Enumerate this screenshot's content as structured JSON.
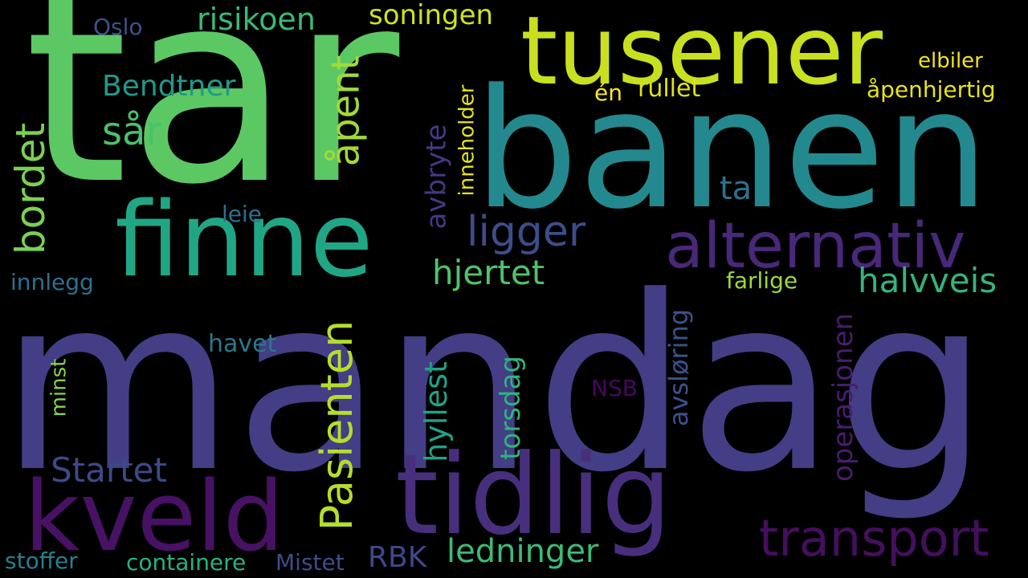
{
  "words": [
    {
      "text": "mandag",
      "color": "#433e85"
    },
    {
      "text": "tar",
      "color": "#5cc863"
    },
    {
      "text": "banen",
      "color": "#23898e"
    },
    {
      "text": "tusener",
      "color": "#c8e020"
    },
    {
      "text": "finne",
      "color": "#21a685"
    },
    {
      "text": "tidlig",
      "color": "#472f7d"
    },
    {
      "text": "kveld",
      "color": "#471164"
    },
    {
      "text": "alternativ",
      "color": "#482878"
    },
    {
      "text": "transport",
      "color": "#440f5d"
    },
    {
      "text": "Pasienten",
      "color": "#b5de2b"
    },
    {
      "text": "risikoen",
      "color": "#3aba76"
    },
    {
      "text": "soningen",
      "color": "#d0e11c"
    },
    {
      "text": "Bendtner",
      "color": "#1f9a8a"
    },
    {
      "text": "sår",
      "color": "#4ac16d"
    },
    {
      "text": "åpent",
      "color": "#a2da37"
    },
    {
      "text": "bordet",
      "color": "#7ad151"
    },
    {
      "text": "ligger",
      "color": "#3e4c8a"
    },
    {
      "text": "hjertet",
      "color": "#4ec36b"
    },
    {
      "text": "halvveis",
      "color": "#34b679"
    },
    {
      "text": "ta",
      "color": "#2c728e"
    },
    {
      "text": "avbryte",
      "color": "#443983"
    },
    {
      "text": "inneholder",
      "color": "#e5e419"
    },
    {
      "text": "Oslo",
      "color": "#3b528b"
    },
    {
      "text": "elbiler",
      "color": "#f1e51d"
    },
    {
      "text": "åpenhjertig",
      "color": "#e7e419"
    },
    {
      "text": "én",
      "color": "#fde725"
    },
    {
      "text": "rullet",
      "color": "#dde318"
    },
    {
      "text": "leie",
      "color": "#2d708e"
    },
    {
      "text": "innlegg",
      "color": "#2c718e"
    },
    {
      "text": "farlige",
      "color": "#9dd93b"
    },
    {
      "text": "avsløring",
      "color": "#3b528b"
    },
    {
      "text": "operasjonen",
      "color": "#481d6f"
    },
    {
      "text": "havet",
      "color": "#2a788e"
    },
    {
      "text": "hyllest",
      "color": "#20a386"
    },
    {
      "text": "torsdag",
      "color": "#2fb47c"
    },
    {
      "text": "NSB",
      "color": "#46085c"
    },
    {
      "text": "minst",
      "color": "#84d44b"
    },
    {
      "text": "Startet",
      "color": "#3e4989"
    },
    {
      "text": "RBK",
      "color": "#3f4889"
    },
    {
      "text": "ledninger",
      "color": "#3cbb75"
    },
    {
      "text": "stoffer",
      "color": "#277f8e"
    },
    {
      "text": "containere",
      "color": "#2ab07f"
    },
    {
      "text": "Mistet",
      "color": "#3d4d8a"
    }
  ]
}
